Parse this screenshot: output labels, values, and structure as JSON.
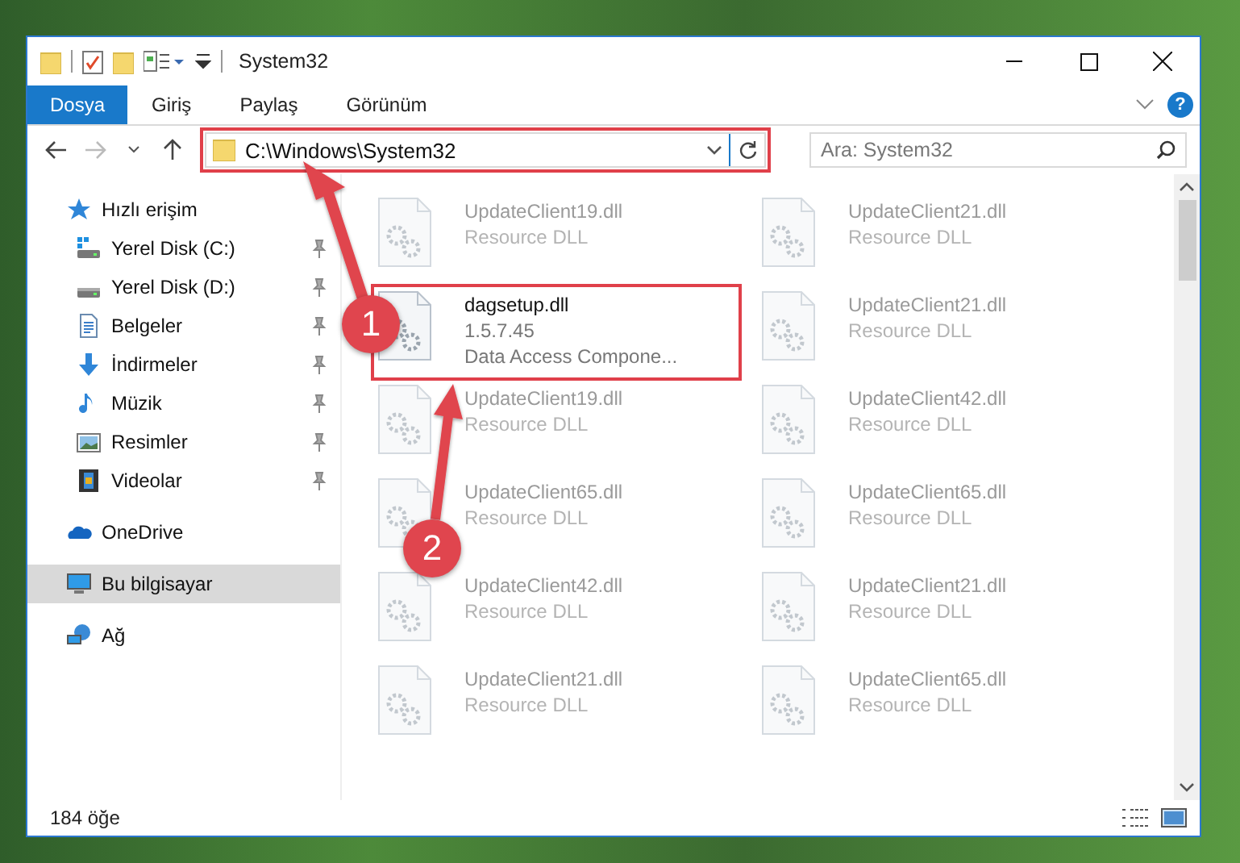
{
  "window": {
    "title": "System32"
  },
  "ribbon_tabs": [
    {
      "label": "Dosya",
      "selected": true
    },
    {
      "label": "Giriş",
      "selected": false
    },
    {
      "label": "Paylaş",
      "selected": false
    },
    {
      "label": "Görünüm",
      "selected": false
    }
  ],
  "ribbon_help": "?",
  "address": {
    "value": "C:\\Windows\\System32",
    "highlighted": true
  },
  "search": {
    "placeholder": "Ara: System32"
  },
  "sidebar": {
    "items": [
      {
        "label": "Hızlı erişim",
        "kind": "star",
        "selected": false,
        "children": [
          {
            "label": "Yerel Disk (C:)",
            "kind": "system-drive",
            "pinned": true,
            "selected": false
          },
          {
            "label": "Yerel Disk (D:)",
            "kind": "drive",
            "pinned": true,
            "selected": false
          },
          {
            "label": "Belgeler",
            "kind": "document",
            "pinned": true,
            "selected": false
          },
          {
            "label": "İndirmeler",
            "kind": "download",
            "pinned": true,
            "selected": false
          },
          {
            "label": "Müzik",
            "kind": "music",
            "pinned": true,
            "selected": false
          },
          {
            "label": "Resimler",
            "kind": "picture",
            "pinned": true,
            "selected": false
          },
          {
            "label": "Videolar",
            "kind": "video",
            "pinned": true,
            "selected": false
          }
        ]
      },
      {
        "label": "OneDrive",
        "kind": "cloud",
        "selected": false
      },
      {
        "label": "Bu bilgisayar",
        "kind": "computer",
        "selected": true
      },
      {
        "label": "Ağ",
        "kind": "network",
        "selected": false
      }
    ]
  },
  "files": [
    {
      "name": "UpdateClient19.dll",
      "lines": [
        "Resource DLL"
      ],
      "blurred": true,
      "highlighted": false
    },
    {
      "name": "UpdateClient21.dll",
      "lines": [
        "Resource DLL"
      ],
      "blurred": true,
      "highlighted": false
    },
    {
      "name": "dagsetup.dll",
      "lines": [
        "1.5.7.45",
        "Data Access Compone..."
      ],
      "blurred": false,
      "highlighted": true
    },
    {
      "name": "UpdateClient21.dll",
      "lines": [
        "Resource DLL"
      ],
      "blurred": true,
      "highlighted": false
    },
    {
      "name": "UpdateClient19.dll",
      "lines": [
        "Resource DLL"
      ],
      "blurred": true,
      "highlighted": false
    },
    {
      "name": "UpdateClient42.dll",
      "lines": [
        "Resource DLL"
      ],
      "blurred": true,
      "highlighted": false
    },
    {
      "name": "UpdateClient65.dll",
      "lines": [
        "Resource DLL"
      ],
      "blurred": true,
      "highlighted": false
    },
    {
      "name": "UpdateClient65.dll",
      "lines": [
        "Resource DLL"
      ],
      "blurred": true,
      "highlighted": false
    },
    {
      "name": "UpdateClient42.dll",
      "lines": [
        "Resource DLL"
      ],
      "blurred": true,
      "highlighted": false
    },
    {
      "name": "UpdateClient21.dll",
      "lines": [
        "Resource DLL"
      ],
      "blurred": true,
      "highlighted": false
    },
    {
      "name": "UpdateClient21.dll",
      "lines": [
        "Resource DLL"
      ],
      "blurred": true,
      "highlighted": false
    },
    {
      "name": "UpdateClient65.dll",
      "lines": [
        "Resource DLL"
      ],
      "blurred": true,
      "highlighted": false
    }
  ],
  "status_bar": {
    "item_count": "184 öğe"
  },
  "annotations": [
    {
      "number": "1"
    },
    {
      "number": "2"
    }
  ]
}
